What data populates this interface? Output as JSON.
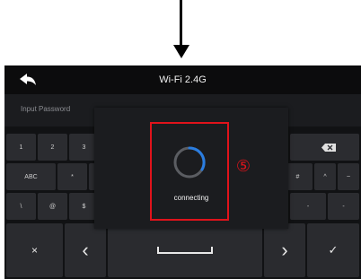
{
  "title": "Wi-Fi 2.4G",
  "password": {
    "placeholder": "Input Password"
  },
  "modal": {
    "status_text": "connecting"
  },
  "annotation": {
    "step_marker": "⑤"
  },
  "keyboard": {
    "row1": [
      "1",
      "2",
      "3",
      "",
      "",
      "",
      "",
      "",
      "",
      "",
      "",
      ""
    ],
    "row2": [
      "ABC",
      "*",
      "#",
      "",
      "",
      "",
      "",
      "",
      "",
      "#",
      "^",
      "~"
    ],
    "row3": [
      "\\",
      "@",
      "$",
      "",
      "",
      "",
      "",
      "",
      "",
      "",
      "-",
      "-"
    ],
    "backspace_icon": "backspace-icon"
  },
  "bottom_bar": {
    "close_icon": "×",
    "prev_icon": "‹",
    "next_icon": "›",
    "confirm_icon": "✓"
  },
  "colors": {
    "screen_bg": "#111214",
    "key_bg": "#2b2c30",
    "spinner_accent": "#2a7de1",
    "highlight": "#e0131b"
  }
}
